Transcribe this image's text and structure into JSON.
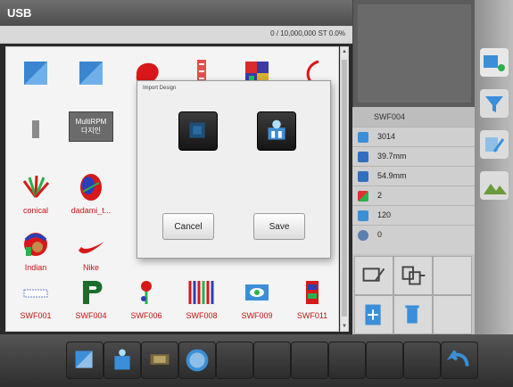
{
  "window": {
    "title": "USB",
    "stitch_counter": "0 / 10,000,000 ST  0.0%"
  },
  "designs": [
    {
      "label": "",
      "icon": "blue-square-design"
    },
    {
      "label": "",
      "icon": "blue-square-design"
    },
    {
      "label": "",
      "icon": "red-blob-design"
    },
    {
      "label": "",
      "icon": "red-vertical-design"
    },
    {
      "label": "",
      "icon": "multicolor-block-design"
    },
    {
      "label": "",
      "icon": "red-arc-design"
    },
    {
      "label": "",
      "icon": "gray-strip-design"
    },
    {
      "label": "MultiRPM\n다지인",
      "icon": "multirpm-design"
    },
    {
      "label": "",
      "icon": "empty"
    },
    {
      "label": "",
      "icon": "empty"
    },
    {
      "label": "",
      "icon": "empty"
    },
    {
      "label": "",
      "icon": "empty"
    },
    {
      "label": "conical",
      "icon": "conical-design"
    },
    {
      "label": "dadami_t...",
      "icon": "dadami-design"
    },
    {
      "label": "",
      "icon": "empty"
    },
    {
      "label": "",
      "icon": "empty"
    },
    {
      "label": "",
      "icon": "empty"
    },
    {
      "label": "",
      "icon": "empty"
    },
    {
      "label": "Indian",
      "icon": "indian-head-design"
    },
    {
      "label": "Nike",
      "icon": "nike-swoosh-design"
    },
    {
      "label": "",
      "icon": "green-block-design"
    },
    {
      "label": "",
      "icon": "empty"
    },
    {
      "label": "",
      "icon": "empty"
    },
    {
      "label": "",
      "icon": "empty"
    },
    {
      "label": "SWF001",
      "icon": "swf001-design"
    },
    {
      "label": "SWF004",
      "icon": "swf004-design"
    },
    {
      "label": "SWF006",
      "icon": "swf006-design"
    },
    {
      "label": "SWF008",
      "icon": "swf008-design"
    },
    {
      "label": "SWF009",
      "icon": "swf009-design"
    },
    {
      "label": "SWF011",
      "icon": "swf011-design"
    }
  ],
  "dialog": {
    "title": "Import Design",
    "cancel_label": "Cancel",
    "save_label": "Save"
  },
  "info": {
    "design_name": "SWF004",
    "stitches": "3014",
    "width": "39.7mm",
    "height": "54.9mm",
    "colors": "2",
    "rpm": "120",
    "start": "0"
  },
  "colors": {
    "label_red": "#c41212",
    "accent_blue": "#3a8fd8"
  }
}
